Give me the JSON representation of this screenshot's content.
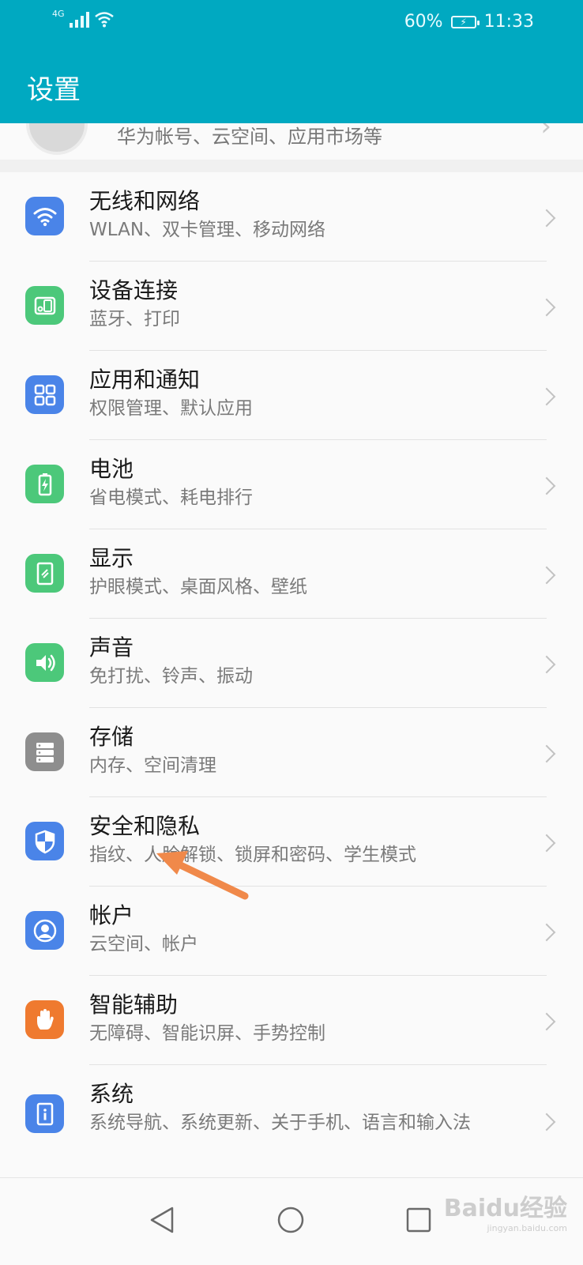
{
  "status_bar": {
    "network": "4G",
    "battery_percent": "60%",
    "time": "11:33"
  },
  "app_bar": {
    "title": "设置"
  },
  "account": {
    "subtitle": "华为帐号、云空间、应用市场等"
  },
  "settings": [
    {
      "id": "wireless",
      "title": "无线和网络",
      "subtitle": "WLAN、双卡管理、移动网络",
      "icon": "wifi-icon",
      "color": "#4a84e8"
    },
    {
      "id": "device",
      "title": "设备连接",
      "subtitle": "蓝牙、打印",
      "icon": "device-connection-icon",
      "color": "#4cc87a"
    },
    {
      "id": "apps",
      "title": "应用和通知",
      "subtitle": "权限管理、默认应用",
      "icon": "apps-grid-icon",
      "color": "#4a84e8"
    },
    {
      "id": "battery",
      "title": "电池",
      "subtitle": "省电模式、耗电排行",
      "icon": "battery-icon",
      "color": "#4cc87a"
    },
    {
      "id": "display",
      "title": "显示",
      "subtitle": "护眼模式、桌面风格、壁纸",
      "icon": "display-icon",
      "color": "#4cc87a"
    },
    {
      "id": "sound",
      "title": "声音",
      "subtitle": "免打扰、铃声、振动",
      "icon": "speaker-icon",
      "color": "#4cc87a"
    },
    {
      "id": "storage",
      "title": "存储",
      "subtitle": "内存、空间清理",
      "icon": "storage-icon",
      "color": "#8e8e8e"
    },
    {
      "id": "security",
      "title": "安全和隐私",
      "subtitle": "指纹、人脸解锁、锁屏和密码、学生模式",
      "icon": "shield-icon",
      "color": "#4a84e8"
    },
    {
      "id": "account",
      "title": "帐户",
      "subtitle": "云空间、帐户",
      "icon": "user-icon",
      "color": "#4a84e8"
    },
    {
      "id": "accessibility",
      "title": "智能辅助",
      "subtitle": "无障碍、智能识屏、手势控制",
      "icon": "hand-icon",
      "color": "#ef7a2f"
    },
    {
      "id": "system",
      "title": "系统",
      "subtitle": "系统导航、系统更新、关于手机、语言和输入法",
      "icon": "system-info-icon",
      "color": "#4a84e8"
    }
  ],
  "annotation": {
    "arrow_color": "#f0894a"
  },
  "watermark": {
    "brand": "Baidu经验",
    "url": "jingyan.baidu.com"
  }
}
